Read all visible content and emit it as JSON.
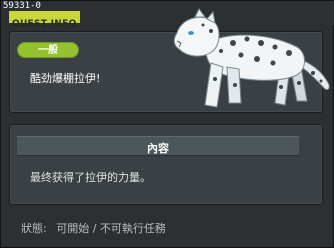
{
  "window": {
    "quest_id": "59331-0",
    "title": "QUEST INFO"
  },
  "quest": {
    "category_badge": "一般",
    "name": "酷劲爆棚拉伊!"
  },
  "content": {
    "header": "內容",
    "description": "最终获得了拉伊的力量。"
  },
  "status": {
    "label": "狀態:",
    "value": "可開始 / 不可執行任務"
  },
  "illustration": {
    "subject": "snow-leopard"
  },
  "colors": {
    "badge": "#95c12f",
    "title_tag": "#c8d63a",
    "panel": "#3b4044",
    "background": "#2c3033"
  }
}
